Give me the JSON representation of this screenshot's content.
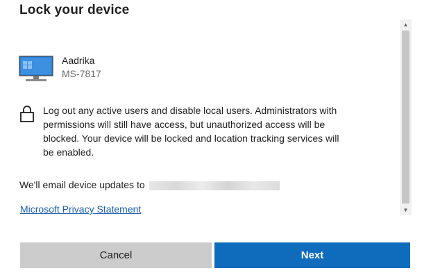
{
  "dialog": {
    "title": "Lock your device"
  },
  "device": {
    "name": "Aadrika",
    "model": "MS-7817",
    "icon": "desktop-monitor-icon"
  },
  "warning": {
    "icon": "lock-icon",
    "text": "Log out any active users and disable local users. Administrators with permissions will still have access, but unauthorized access will be blocked. Your device will be locked and location tracking services will be enabled."
  },
  "email": {
    "label": "We'll email device updates to"
  },
  "privacy": {
    "link_label": "Microsoft Privacy Statement"
  },
  "buttons": {
    "cancel_label": "Cancel",
    "next_label": "Next"
  },
  "colors": {
    "accent": "#0f6cbd",
    "link": "#1a5fb4",
    "cancel_bg": "#cccccc"
  }
}
